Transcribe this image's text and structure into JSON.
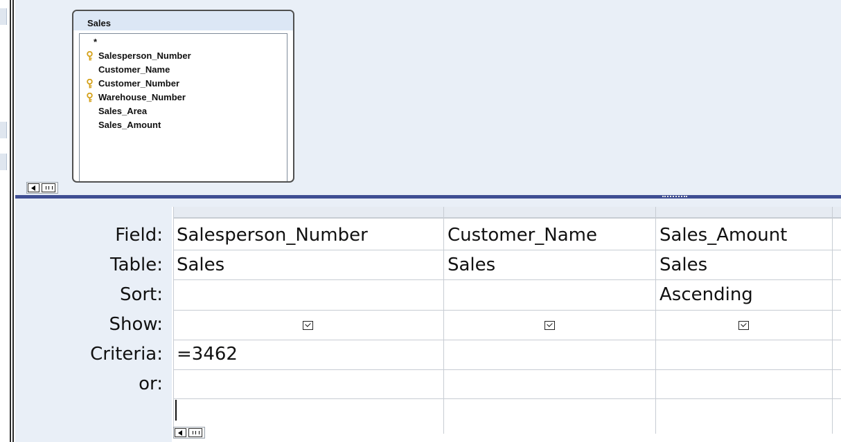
{
  "table_box": {
    "title": "Sales",
    "fields": [
      {
        "label": "*",
        "primary_key": false
      },
      {
        "label": "Salesperson_Number",
        "primary_key": true
      },
      {
        "label": "Customer_Name",
        "primary_key": false
      },
      {
        "label": "Customer_Number",
        "primary_key": true
      },
      {
        "label": "Warehouse_Number",
        "primary_key": true
      },
      {
        "label": "Sales_Area",
        "primary_key": false
      },
      {
        "label": "Sales_Amount",
        "primary_key": false
      }
    ]
  },
  "design_grid": {
    "row_labels": [
      "Field:",
      "Table:",
      "Sort:",
      "Show:",
      "Criteria:",
      "or:"
    ],
    "columns": [
      {
        "field": "Salesperson_Number",
        "table": "Sales",
        "sort": "",
        "show": true,
        "criteria": "=3462",
        "or": ""
      },
      {
        "field": "Customer_Name",
        "table": "Sales",
        "sort": "",
        "show": true,
        "criteria": "",
        "or": ""
      },
      {
        "field": "Sales_Amount",
        "table": "Sales",
        "sort": "Ascending",
        "show": true,
        "criteria": "",
        "or": ""
      }
    ]
  },
  "icons": {
    "primary_key": "key-icon",
    "show_checkbox": "checkbox-checked-icon",
    "scroll_left": "scroll-left-arrow-icon",
    "scroll_thumb": "scroll-thumb-grip-icon"
  },
  "colors": {
    "pane_background": "#e9eff7",
    "splitter": "#3f4e93",
    "grid_lines": "#c7ccd3",
    "key_icon": "#d4a017"
  }
}
